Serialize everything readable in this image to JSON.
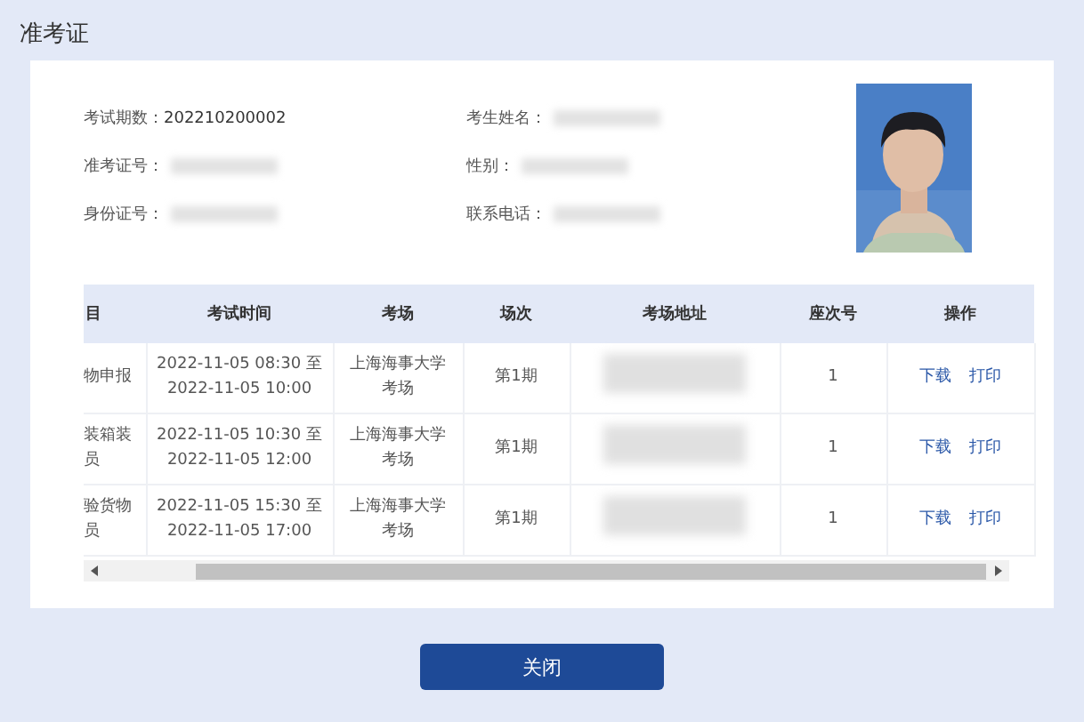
{
  "page_title": "准考证",
  "info_fields": [
    {
      "label": "考试期数：",
      "value": "202210200002",
      "redacted": false
    },
    {
      "label": "考生姓名：",
      "redacted": true
    },
    {
      "label": "准考证号：",
      "redacted": true
    },
    {
      "label": "性别：",
      "redacted": true
    },
    {
      "label": "身份证号：",
      "redacted": true
    },
    {
      "label": "联系电话：",
      "redacted": true
    }
  ],
  "table": {
    "columns": [
      "目",
      "考试时间",
      "考场",
      "场次",
      "考场地址",
      "座次号",
      "操作"
    ],
    "rows": [
      {
        "column_1": "物申报",
        "time": "2022-11-05 08:30 至 2022-11-05 10:00",
        "venue": "上海海事大学考场",
        "session": "第1期",
        "address_redacted": true,
        "seat": "1",
        "actions": [
          "下载",
          "打印"
        ]
      },
      {
        "column_1": "装箱装员",
        "time": "2022-11-05 10:30 至 2022-11-05 12:00",
        "venue": "上海海事大学考场",
        "session": "第1期",
        "address_redacted": true,
        "seat": "1",
        "actions": [
          "下载",
          "打印"
        ]
      },
      {
        "column_1": "验货物员",
        "time": "2022-11-05 15:30 至 2022-11-05 17:00",
        "venue": "上海海事大学考场",
        "session": "第1期",
        "address_redacted": true,
        "seat": "1",
        "actions": [
          "下载",
          "打印"
        ]
      }
    ]
  },
  "close_button": "关闭"
}
